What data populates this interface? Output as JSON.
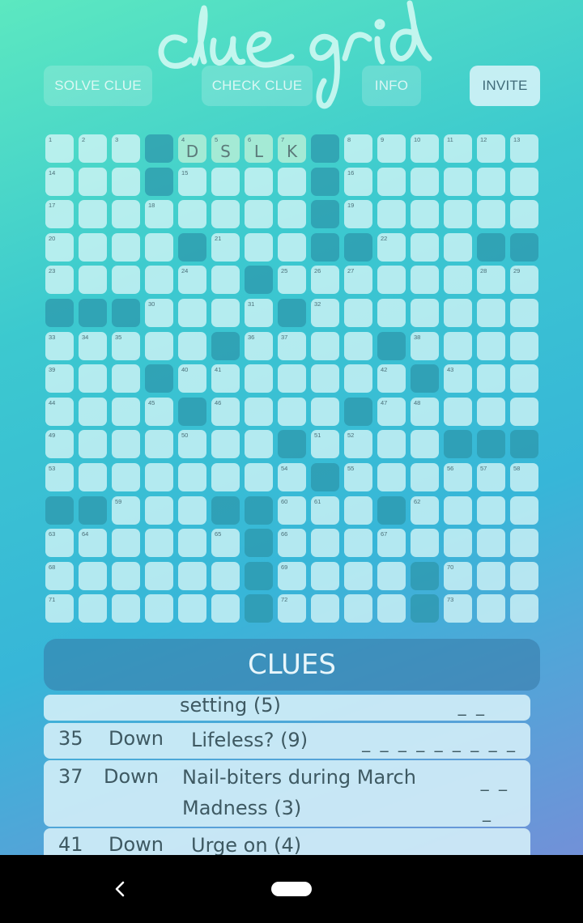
{
  "app": {
    "logo_text": "cluegrid"
  },
  "toolbar": {
    "solve": "SOLVE CLUE",
    "check": "CHECK CLUE",
    "info": "INFO",
    "invite": "INVITE"
  },
  "grid": {
    "cols": 15,
    "rows": 15,
    "cells": [
      [
        "1",
        "2",
        "3",
        "#",
        "4",
        "5",
        "6",
        "7",
        "#",
        "8",
        "9",
        "10",
        "11",
        "12",
        "13"
      ],
      [
        "14",
        ".",
        ".",
        "#",
        "15",
        ".",
        ".",
        ".",
        "#",
        "16",
        ".",
        ".",
        ".",
        ".",
        "."
      ],
      [
        "17",
        ".",
        ".",
        "18",
        ".",
        ".",
        ".",
        ".",
        "#",
        "19",
        ".",
        ".",
        ".",
        ".",
        "."
      ],
      [
        "20",
        ".",
        ".",
        ".",
        "#",
        "21",
        ".",
        ".",
        "#",
        "#",
        "22",
        ".",
        ".",
        "#",
        "#"
      ],
      [
        "23",
        ".",
        ".",
        ".",
        "24",
        ".",
        "#",
        "25",
        "26",
        "27",
        ".",
        ".",
        ".",
        "28",
        "29"
      ],
      [
        "#",
        "#",
        "#",
        "30",
        ".",
        ".",
        "31",
        "#",
        "32",
        ".",
        ".",
        ".",
        ".",
        ".",
        "."
      ],
      [
        "33",
        "34",
        "35",
        ".",
        ".",
        "#",
        "36",
        "37",
        ".",
        ".",
        "#",
        "38",
        ".",
        ".",
        "."
      ],
      [
        "39",
        ".",
        ".",
        "#",
        "40",
        "41",
        ".",
        ".",
        ".",
        ".",
        "42",
        "#",
        "43",
        ".",
        "."
      ],
      [
        "44",
        ".",
        ".",
        "45",
        "#",
        "46",
        ".",
        ".",
        ".",
        "#",
        "47",
        "48",
        ".",
        ".",
        "."
      ],
      [
        "49",
        ".",
        ".",
        ".",
        "50",
        ".",
        ".",
        "#",
        "51",
        "52",
        ".",
        ".",
        "#",
        "#",
        "#"
      ],
      [
        "53",
        ".",
        ".",
        ".",
        ".",
        ".",
        ".",
        "54",
        "#",
        "55",
        ".",
        ".",
        "56",
        "57",
        "58"
      ],
      [
        "#",
        "#",
        "59",
        ".",
        ".",
        "#",
        "#",
        "60",
        "61",
        ".",
        "#",
        "62",
        ".",
        ".",
        "."
      ],
      [
        "63",
        "64",
        ".",
        ".",
        ".",
        "65",
        "#",
        "66",
        ".",
        ".",
        "67",
        ".",
        ".",
        ".",
        "."
      ],
      [
        "68",
        ".",
        ".",
        ".",
        ".",
        ".",
        "#",
        "69",
        ".",
        ".",
        ".",
        "#",
        "70",
        ".",
        "."
      ],
      [
        "71",
        ".",
        ".",
        ".",
        ".",
        ".",
        "#",
        "72",
        ".",
        ".",
        ".",
        "#",
        "73",
        ".",
        "."
      ]
    ],
    "entries": {
      "0-4": "D",
      "0-5": "S",
      "0-6": "L",
      "0-7": "K"
    },
    "highlight": [
      "0-4",
      "0-5",
      "0-6",
      "0-7"
    ]
  },
  "clues": {
    "header": "CLUES",
    "items": [
      {
        "number": "",
        "direction": "",
        "text": "setting (5)",
        "blanks": "_ _"
      },
      {
        "number": "35",
        "direction": "Down",
        "text": "Lifeless? (9)",
        "blanks": "_ _ _ _ _ _ _ _ _"
      },
      {
        "number": "37",
        "direction": "Down",
        "text": "Nail-biters during March Madness (3)",
        "blanks": "_ _",
        "blanks2": "_"
      },
      {
        "number": "41",
        "direction": "Down",
        "text": "Urge on (4)",
        "blanks": "_ _ _ _"
      }
    ]
  },
  "colors": {
    "gradient_start": "#5ce8c0",
    "gradient_end": "#7c8ad8",
    "cell": "#d6f6f7",
    "black_cell": "#2c96aa",
    "highlight_cell": "#adecd6"
  },
  "nav": {
    "back_icon": "back-icon",
    "home_icon": "home-pill-icon"
  }
}
